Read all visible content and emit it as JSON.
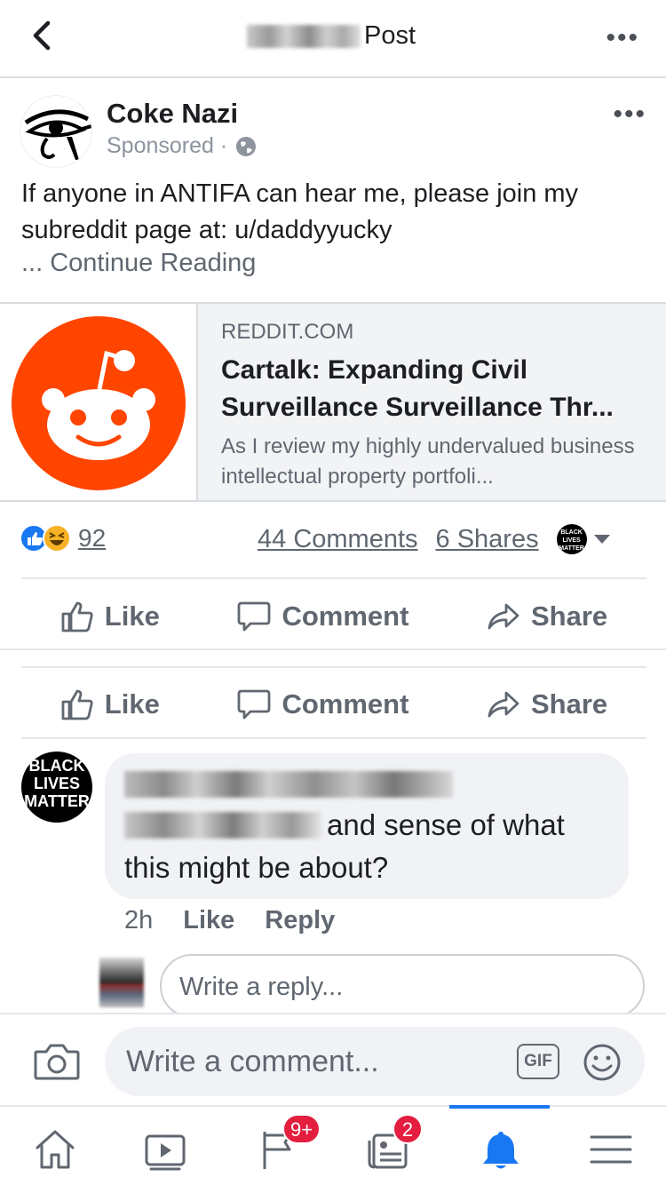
{
  "header": {
    "title": "Post",
    "more_label": "•••"
  },
  "post": {
    "author": "Coke Nazi",
    "sponsored": "Sponsored ·",
    "more_label": "•••",
    "text": "If anyone in ANTIFA can hear me, please join my subreddit page at: u/daddyyucky",
    "continue": "... Continue Reading"
  },
  "link_card": {
    "domain": "REDDIT.COM",
    "title": "Cartalk: Expanding Civil Surveillance Surveillance Thr...",
    "description": "As I review my highly undervalued business intellectual property portfoli...",
    "accent_color": "#ff4500"
  },
  "reactions": {
    "count": "92",
    "comments": "44 Comments",
    "shares": "6 Shares",
    "badge_text": "BLACK LIVES MATTER"
  },
  "actions_primary": {
    "like": "Like",
    "comment": "Comment",
    "share": "Share"
  },
  "actions_secondary": {
    "like": "Like",
    "comment": "Comment",
    "share": "Share"
  },
  "comment": {
    "avatar_text": [
      "BLACK",
      "LIVES",
      "MATTER"
    ],
    "text_line1_end": "and sense of what",
    "text_line2": "this might be about?",
    "time": "2h",
    "like": "Like",
    "reply": "Reply"
  },
  "reply": {
    "placeholder": "Write a reply..."
  },
  "composer": {
    "placeholder": "Write a comment...",
    "gif": "GIF"
  },
  "tabbar": {
    "badges": {
      "feed_updates": "9+",
      "news": "2"
    },
    "active_tab": "notifications",
    "active_color": "#1877f2"
  }
}
